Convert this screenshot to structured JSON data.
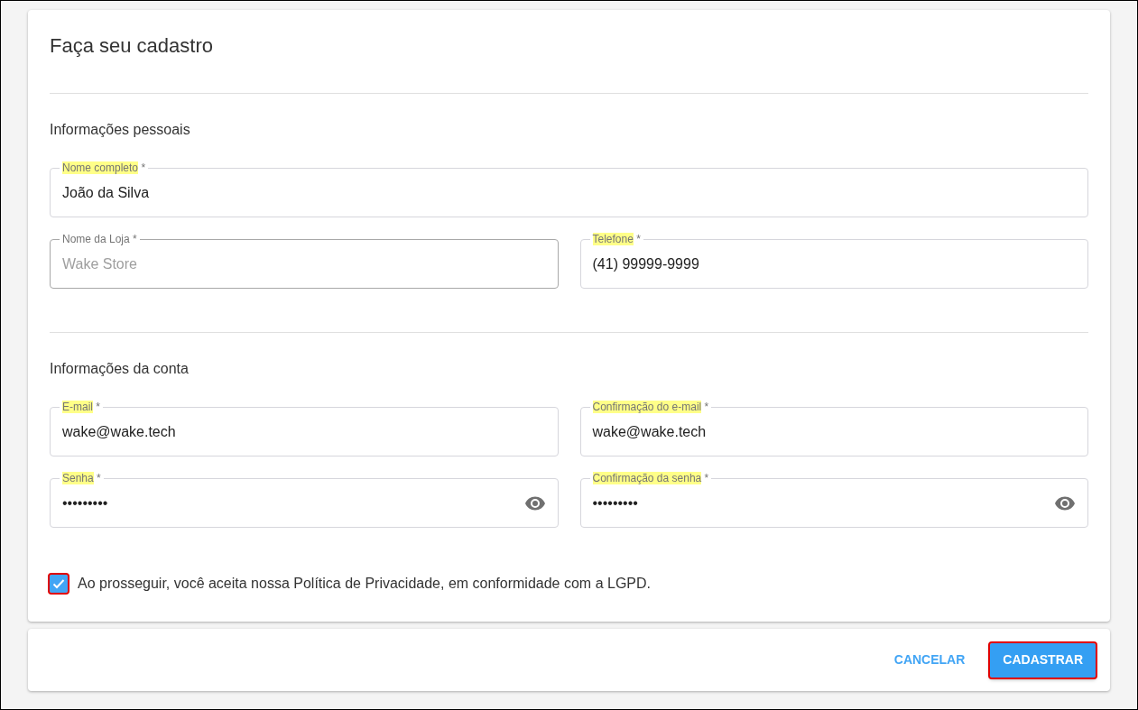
{
  "title": "Faça seu cadastro",
  "sections": [
    {
      "heading": "Informações pessoais",
      "rows": [
        [
          {
            "kind": "text",
            "label": "Nome completo",
            "required_mark": "*",
            "highlighted": true,
            "value": "João da Silva"
          }
        ],
        [
          {
            "kind": "text",
            "label": "Nome da Loja",
            "required_mark": "*",
            "highlighted": false,
            "placeholder": "Wake Store"
          },
          {
            "kind": "text",
            "label": "Telefone",
            "required_mark": "*",
            "highlighted": true,
            "value": "(41) 99999-9999"
          }
        ]
      ]
    },
    {
      "heading": "Informações da conta",
      "rows": [
        [
          {
            "kind": "text",
            "label": "E-mail",
            "required_mark": "*",
            "highlighted": true,
            "value": "wake@wake.tech"
          },
          {
            "kind": "text",
            "label": "Confirmação do e-mail",
            "required_mark": "*",
            "highlighted": true,
            "value": "wake@wake.tech"
          }
        ],
        [
          {
            "kind": "password",
            "label": "Senha",
            "required_mark": "*",
            "highlighted": true,
            "value": "•••••••••"
          },
          {
            "kind": "password",
            "label": "Confirmação da senha",
            "required_mark": "*",
            "highlighted": true,
            "value": "•••••••••"
          }
        ]
      ]
    }
  ],
  "consent": {
    "text": "Ao prosseguir, você aceita nossa Política de Privacidade, em conformidade com a LGPD.",
    "checked": true,
    "outlined": true
  },
  "actions": [
    {
      "kind": "text",
      "label": "CANCELAR",
      "outlined": false
    },
    {
      "kind": "contained",
      "label": "CADASTRAR",
      "outlined": true
    }
  ]
}
